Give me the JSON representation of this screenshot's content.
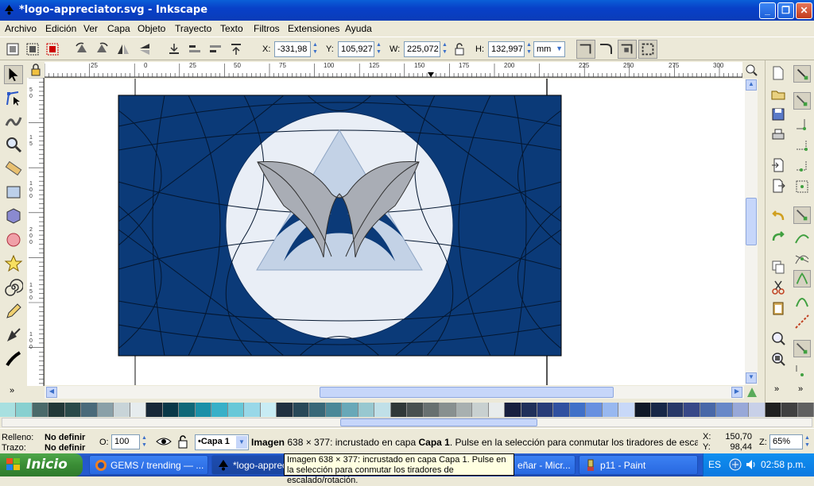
{
  "window": {
    "title": "*logo-appreciator.svg - Inkscape"
  },
  "menu": [
    "Archivo",
    "Edición",
    "Ver",
    "Capa",
    "Objeto",
    "Trayecto",
    "Texto",
    "Filtros",
    "Extensiones",
    "Ayuda"
  ],
  "toolbar": {
    "x_label": "X:",
    "x_value": "-331,98",
    "y_label": "Y:",
    "y_value": "105,927",
    "w_label": "W:",
    "w_value": "225,072",
    "h_label": "H:",
    "h_value": "132,997",
    "unit": "mm"
  },
  "ruler_h": [
    "25",
    "0",
    "25",
    "50",
    "75",
    "100",
    "125",
    "150",
    "175",
    "200",
    "225",
    "250",
    "275",
    "300"
  ],
  "ruler_v": [
    "5",
    "0",
    "1",
    "5",
    "1",
    "0",
    "0",
    "2",
    "0",
    "0",
    "1",
    "5",
    "0",
    "1",
    "0",
    "0"
  ],
  "status": {
    "fill_label": "Relleno:",
    "fill_value": "No definir",
    "stroke_label": "Trazo:",
    "stroke_value": "No definir",
    "opacity_label": "O:",
    "opacity_value": "100",
    "layer": "•Capa 1",
    "message_bold": "Imagen",
    "message": " 638 × 377: incrustado en capa ",
    "message_layer": "Capa 1",
    "message_tail": ". Pulse en la selección para conmutar los tiradores de escalado/rot...",
    "x_label": "X:",
    "x_value": "150,70",
    "y_label": "Y:",
    "y_value": "98,44",
    "zoom_label": "Z:",
    "zoom_value": "65%"
  },
  "tooltip": "Imagen 638 × 377: incrustado en capa Capa 1. Pulse en la selección para conmutar los tiradores de escalado/rotación.",
  "taskbar": {
    "start": "Inicio",
    "tasks": [
      "GEMS / trending — ...",
      "*logo-apprec",
      "eñar - Micr...",
      "p11 - Paint"
    ],
    "lang": "ES",
    "clock": "02:58 p.m."
  },
  "colors": {
    "flag_blue": "#0b3a78",
    "disc": "#e9eef6",
    "triangle": "#c3d2e6",
    "accent": "#0a5fd8"
  }
}
